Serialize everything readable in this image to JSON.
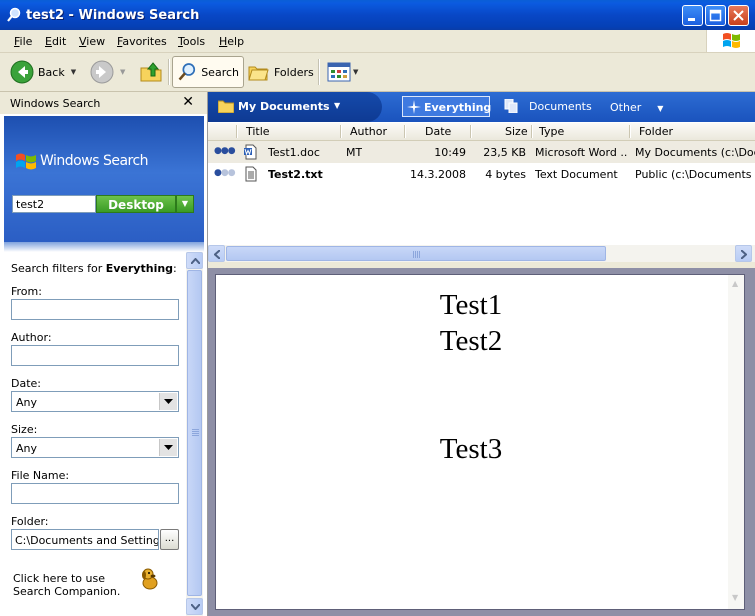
{
  "window": {
    "title": "test2 - Windows Search"
  },
  "menu": {
    "items": [
      {
        "label": "File",
        "key": "F",
        "rest": "ile"
      },
      {
        "label": "Edit",
        "key": "E",
        "rest": "dit"
      },
      {
        "label": "View",
        "key": "V",
        "rest": "iew"
      },
      {
        "label": "Favorites",
        "key": "F",
        "rest": "avorites"
      },
      {
        "label": "Tools",
        "key": "T",
        "rest": "ools"
      },
      {
        "label": "Help",
        "key": "H",
        "rest": "elp"
      }
    ]
  },
  "toolbar": {
    "back": "Back",
    "search": "Search",
    "folders": "Folders"
  },
  "left_pane": {
    "header": "Windows Search",
    "brand": "Windows Search",
    "query": "test2",
    "scope": "Desktop",
    "filters": {
      "heading_prefix": "Search filters for ",
      "heading_scope": "Everything",
      "heading_suffix": ":",
      "from_label": "From:",
      "from_value": "",
      "author_label": "Author:",
      "author_value": "",
      "date_label": "Date:",
      "date_value": "Any",
      "size_label": "Size:",
      "size_value": "Any",
      "filename_label": "File Name:",
      "filename_value": "",
      "folder_label": "Folder:",
      "folder_value": "C:\\Documents and Settings\\pa",
      "browse": "...",
      "companion": "Click here to use Search Companion."
    }
  },
  "scope_bar": {
    "location": "My Documents",
    "tabs": {
      "everything": "Everything",
      "documents": "Documents",
      "other": "Other"
    }
  },
  "results": {
    "columns": [
      "Title",
      "Author",
      "Date",
      "Size",
      "Type",
      "Folder"
    ],
    "rows": [
      {
        "relevance": 3,
        "title": "Test1.doc",
        "author": "MT",
        "date": "10:49",
        "size": "23,5 KB",
        "type": "Microsoft Word ...",
        "folder": "My Documents (c:\\Docum",
        "icon": "word-doc-icon"
      },
      {
        "relevance": 1,
        "title": "Test2.txt",
        "author": "",
        "date": "14.3.2008",
        "size": "4 bytes",
        "type": "Text Document",
        "folder": "Public (c:\\Documents an",
        "icon": "text-file-icon"
      }
    ]
  },
  "preview": {
    "lines": [
      "Test1",
      "Test2",
      "Test3"
    ]
  },
  "colors": {
    "titlebar": "#0847c6",
    "scope_button": "#3a9b25",
    "scope_bar": "#1a53bd"
  }
}
